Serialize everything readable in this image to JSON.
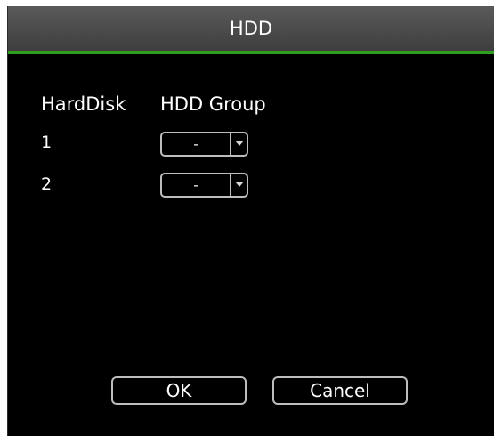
{
  "dialog": {
    "title": "HDD",
    "accent_color": "#2e9e1f"
  },
  "table": {
    "headers": {
      "harddisk": "HardDisk",
      "hdd_group": "HDD Group"
    },
    "rows": [
      {
        "label": "1",
        "group_value": "-"
      },
      {
        "label": "2",
        "group_value": "-"
      }
    ]
  },
  "buttons": {
    "ok_label": "OK",
    "cancel_label": "Cancel"
  },
  "icons": {
    "dropdown": "chevron-down-icon"
  }
}
